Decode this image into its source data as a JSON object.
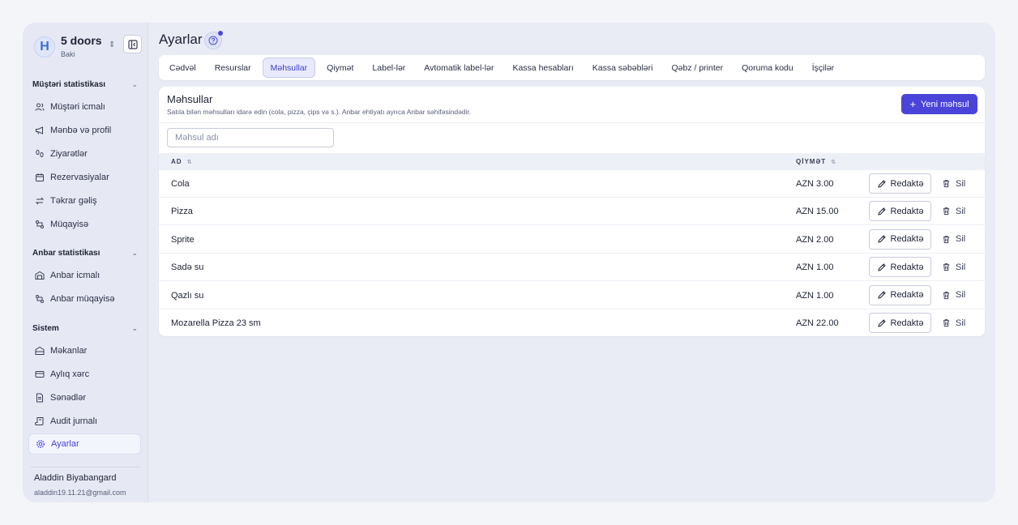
{
  "brand": {
    "name": "5 doors",
    "city": "Baki"
  },
  "sidebar": {
    "sections": [
      {
        "title": "Müştəri statistikası",
        "items": [
          "Müştəri icmalı",
          "Mənbə və profil",
          "Ziyarətlər",
          "Rezervasiyalar",
          "Təkrar gəliş",
          "Müqayisə"
        ]
      },
      {
        "title": "Anbar statistikası",
        "items": [
          "Anbar icmalı",
          "Anbar müqayisə"
        ]
      },
      {
        "title": "Sistem",
        "items": [
          "Məkanlar",
          "Aylıq xərc",
          "Sənədlər",
          "Audit jurnalı",
          "Ayarlar"
        ]
      }
    ],
    "active_item": "Ayarlar"
  },
  "user": {
    "name": "Aladdin Biyabangard",
    "email": "aladdin19.11.21@gmail.com"
  },
  "page": {
    "title": "Ayarlar"
  },
  "tabs": [
    "Cədvəl",
    "Resurslar",
    "Məhsullar",
    "Qiymət",
    "Label-lər",
    "Avtomatik label-lər",
    "Kassa hesabları",
    "Kassa səbəbləri",
    "Qəbz / printer",
    "Qoruma kodu",
    "İşçilər"
  ],
  "active_tab": "Məhsullar",
  "card": {
    "title": "Məhsullar",
    "subtitle": "Satıla bilən məhsulları idarə edin (cola, pizza, çips və s.). Anbar ehtiyatı ayrıca Anbar səhifəsindədir.",
    "new_button": "Yeni məhsul",
    "search_placeholder": "Məhsul adı"
  },
  "table": {
    "columns": {
      "name": "AD",
      "price": "QİYMƏT"
    },
    "edit_label": "Redaktə",
    "delete_label": "Sil",
    "rows": [
      {
        "name": "Cola",
        "price": "AZN 3.00"
      },
      {
        "name": "Pizza",
        "price": "AZN 15.00"
      },
      {
        "name": "Sprite",
        "price": "AZN 2.00"
      },
      {
        "name": "Sadə su",
        "price": "AZN 1.00"
      },
      {
        "name": "Qazlı su",
        "price": "AZN 1.00"
      },
      {
        "name": "Mozarella Pizza 23 sm",
        "price": "AZN 22.00"
      }
    ]
  },
  "colors": {
    "accent": "#4a44d8",
    "active_tab_bg": "#e8eafb",
    "sidebar_bg": "#e6e9f4"
  }
}
